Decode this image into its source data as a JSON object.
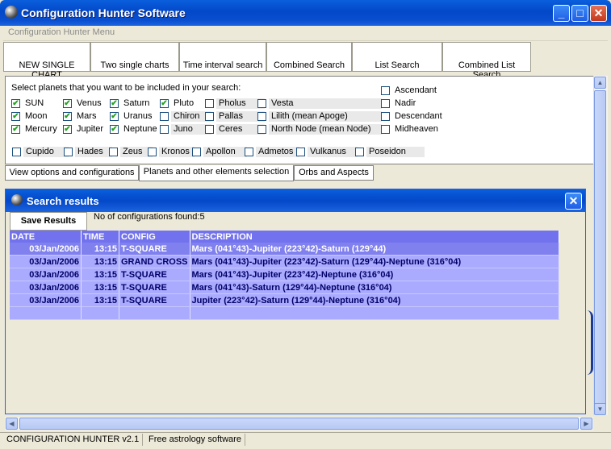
{
  "window": {
    "title": "Configuration Hunter Software",
    "minimize": "_",
    "maximize": "□",
    "close": "✕",
    "icon": "globe-icon"
  },
  "menu": {
    "item": "Configuration Hunter Menu"
  },
  "toolbar": [
    "NEW SINGLE CHART",
    "Two single charts",
    "Time interval search",
    "Combined Search",
    "List Search",
    "Combined List Search"
  ],
  "options": {
    "caption": "Select planets that you want to be included in your search:",
    "planets": [
      {
        "label": "SUN",
        "checked": true
      },
      {
        "label": "Moon",
        "checked": true
      },
      {
        "label": "Mercury",
        "checked": true
      },
      {
        "label": "Venus",
        "checked": true
      },
      {
        "label": "Mars",
        "checked": true
      },
      {
        "label": "Jupiter",
        "checked": true
      },
      {
        "label": "Saturn",
        "checked": true
      },
      {
        "label": "Uranus",
        "checked": true
      },
      {
        "label": "Neptune",
        "checked": true
      },
      {
        "label": "Pluto",
        "checked": true
      },
      {
        "label": "Chiron",
        "checked": false
      },
      {
        "label": "Juno",
        "checked": false
      },
      {
        "label": "Pholus",
        "checked": false
      },
      {
        "label": "Pallas",
        "checked": false
      },
      {
        "label": "Ceres",
        "checked": false
      },
      {
        "label": "Vesta",
        "checked": false
      },
      {
        "label": "Lilith (mean Apoge)",
        "checked": false
      },
      {
        "label": "North Node (mean Node)",
        "checked": false
      }
    ],
    "points": [
      {
        "label": "Ascendant",
        "checked": false
      },
      {
        "label": "Nadir",
        "checked": false
      },
      {
        "label": "Descendant",
        "checked": false
      },
      {
        "label": "Midheaven",
        "checked": false
      }
    ],
    "uranians": [
      {
        "label": "Cupido",
        "checked": false
      },
      {
        "label": "Hades",
        "checked": false
      },
      {
        "label": "Zeus",
        "checked": false
      },
      {
        "label": "Kronos",
        "checked": false
      },
      {
        "label": "Apollon",
        "checked": false
      },
      {
        "label": "Admetos",
        "checked": false
      },
      {
        "label": "Vulkanus",
        "checked": false
      },
      {
        "label": "Poseidon",
        "checked": false
      }
    ]
  },
  "tabs": [
    "View options and configurations",
    "Planets and other elements selection",
    "Orbs and Aspects"
  ],
  "results": {
    "title": "Search results",
    "close": "✕",
    "save_label": "Save Results",
    "found_text": "No of configurations found:5",
    "columns": [
      "DATE",
      "TIME",
      "CONFIG",
      "DESCRIPTION"
    ],
    "rows": [
      [
        "03/Jan/2006",
        "13:15",
        "T-SQUARE",
        "Mars (041°43)-Jupiter (223°42)-Saturn (129°44)"
      ],
      [
        "03/Jan/2006",
        "13:15",
        "GRAND CROSS",
        "Mars (041°43)-Jupiter (223°42)-Saturn (129°44)-Neptune (316°04)"
      ],
      [
        "03/Jan/2006",
        "13:15",
        "T-SQUARE",
        "Mars (041°43)-Jupiter (223°42)-Neptune (316°04)"
      ],
      [
        "03/Jan/2006",
        "13:15",
        "T-SQUARE",
        "Mars (041°43)-Saturn (129°44)-Neptune (316°04)"
      ],
      [
        "03/Jan/2006",
        "13:15",
        "T-SQUARE",
        "Jupiter (223°42)-Saturn (129°44)-Neptune (316°04)"
      ]
    ]
  },
  "scroll": {
    "up": "▲",
    "down": "▼",
    "left": "◀",
    "right": "▶"
  },
  "status": {
    "app": "CONFIGURATION HUNTER v2.1",
    "tagline": "Free astrology software"
  }
}
